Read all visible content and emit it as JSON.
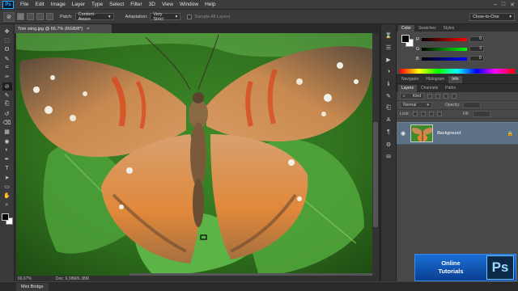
{
  "app": {
    "logo": "Ps"
  },
  "menu": [
    "File",
    "Edit",
    "Image",
    "Layer",
    "Type",
    "Select",
    "Filter",
    "3D",
    "View",
    "Window",
    "Help"
  ],
  "window_controls": [
    "–",
    "□",
    "✕"
  ],
  "options_bar": {
    "tool_icon": "patch-icon",
    "patch_label": "Patch:",
    "patch_value": "Content-Aware",
    "adaptation_label": "Adaptation:",
    "adaptation_value": "Very Strict",
    "sample_all_label": "Sample All Layers",
    "workspace": "Close-to-One"
  },
  "document": {
    "tab_title": "Tom wing.jpg @ 66.7% (RGB/8*)",
    "close": "×",
    "zoom": "66.67%",
    "doc_size": "Doc: 6.38M/6.38M"
  },
  "toolbar_icons": [
    "move-icon",
    "marquee-icon",
    "lasso-icon",
    "quick-select-icon",
    "crop-icon",
    "eyedropper-icon",
    "patch-icon",
    "brush-icon",
    "clone-stamp-icon",
    "history-brush-icon",
    "eraser-icon",
    "gradient-icon",
    "blur-icon",
    "dodge-icon",
    "pen-icon",
    "type-icon",
    "path-select-icon",
    "shape-icon",
    "hand-icon",
    "zoom-icon"
  ],
  "toolbar_glyphs": [
    "✥",
    "⬚",
    "ʘ",
    "✎",
    "⌗",
    "✑",
    "⊘",
    "✎",
    "⎗",
    "↺",
    "⌫",
    "▦",
    "◉",
    "◐",
    "✒",
    "T",
    "➤",
    "▭",
    "✋",
    "⌕"
  ],
  "color_panel": {
    "tabs": [
      "Color",
      "Swatches",
      "Styles"
    ],
    "rows": [
      {
        "label": "R",
        "value": "0"
      },
      {
        "label": "G",
        "value": "0"
      },
      {
        "label": "B",
        "value": "0"
      }
    ]
  },
  "navigator_tabs": [
    "Navigator",
    "Histogram",
    "Info"
  ],
  "layers_panel": {
    "tabs": [
      "Layers",
      "Channels",
      "Paths"
    ],
    "kind": "Kind",
    "blend_mode": "Normal",
    "opacity_label": "Opacity:",
    "lock_label": "Lock:",
    "fill_label": "Fill:",
    "layer_name": "Background",
    "lock_icon": "🔒"
  },
  "bottom_bar": {
    "mini_bridge": "Mini Bridge"
  },
  "branding": {
    "line1": "Online",
    "line2": "Tutorials",
    "logo": "Ps"
  },
  "colors": {
    "accent": "#31a8ff",
    "panel": "#484848",
    "layer_selected": "#5d7186"
  }
}
